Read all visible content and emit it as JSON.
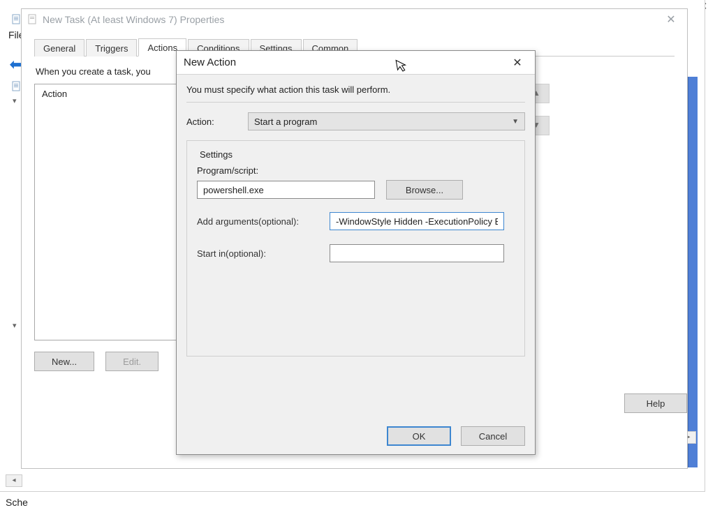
{
  "background": {
    "file_label": "File",
    "sched_label": "Sche",
    "back_arrow": "⬅"
  },
  "props_dialog": {
    "title": "New Task (At least Windows 7) Properties",
    "tabs": [
      "General",
      "Triggers",
      "Actions",
      "Conditions",
      "Settings",
      "Common"
    ],
    "active_tab_index": 2,
    "instruction": "When you create a task, you",
    "list_header": "Action",
    "buttons": {
      "new": "New...",
      "edit": "Edit.",
      "help": "Help"
    }
  },
  "new_action": {
    "title": "New Action",
    "instruction": "You must specify what action this task will perform.",
    "action_label": "Action:",
    "action_value": "Start a program",
    "settings_legend": "Settings",
    "program_label": "Program/script:",
    "program_value": "powershell.exe",
    "browse_label": "Browse...",
    "args_label": "Add arguments(optional):",
    "args_value": "-WindowStyle Hidden -ExecutionPolicy By",
    "startin_label": "Start in(optional):",
    "startin_value": "",
    "ok": "OK",
    "cancel": "Cancel"
  }
}
